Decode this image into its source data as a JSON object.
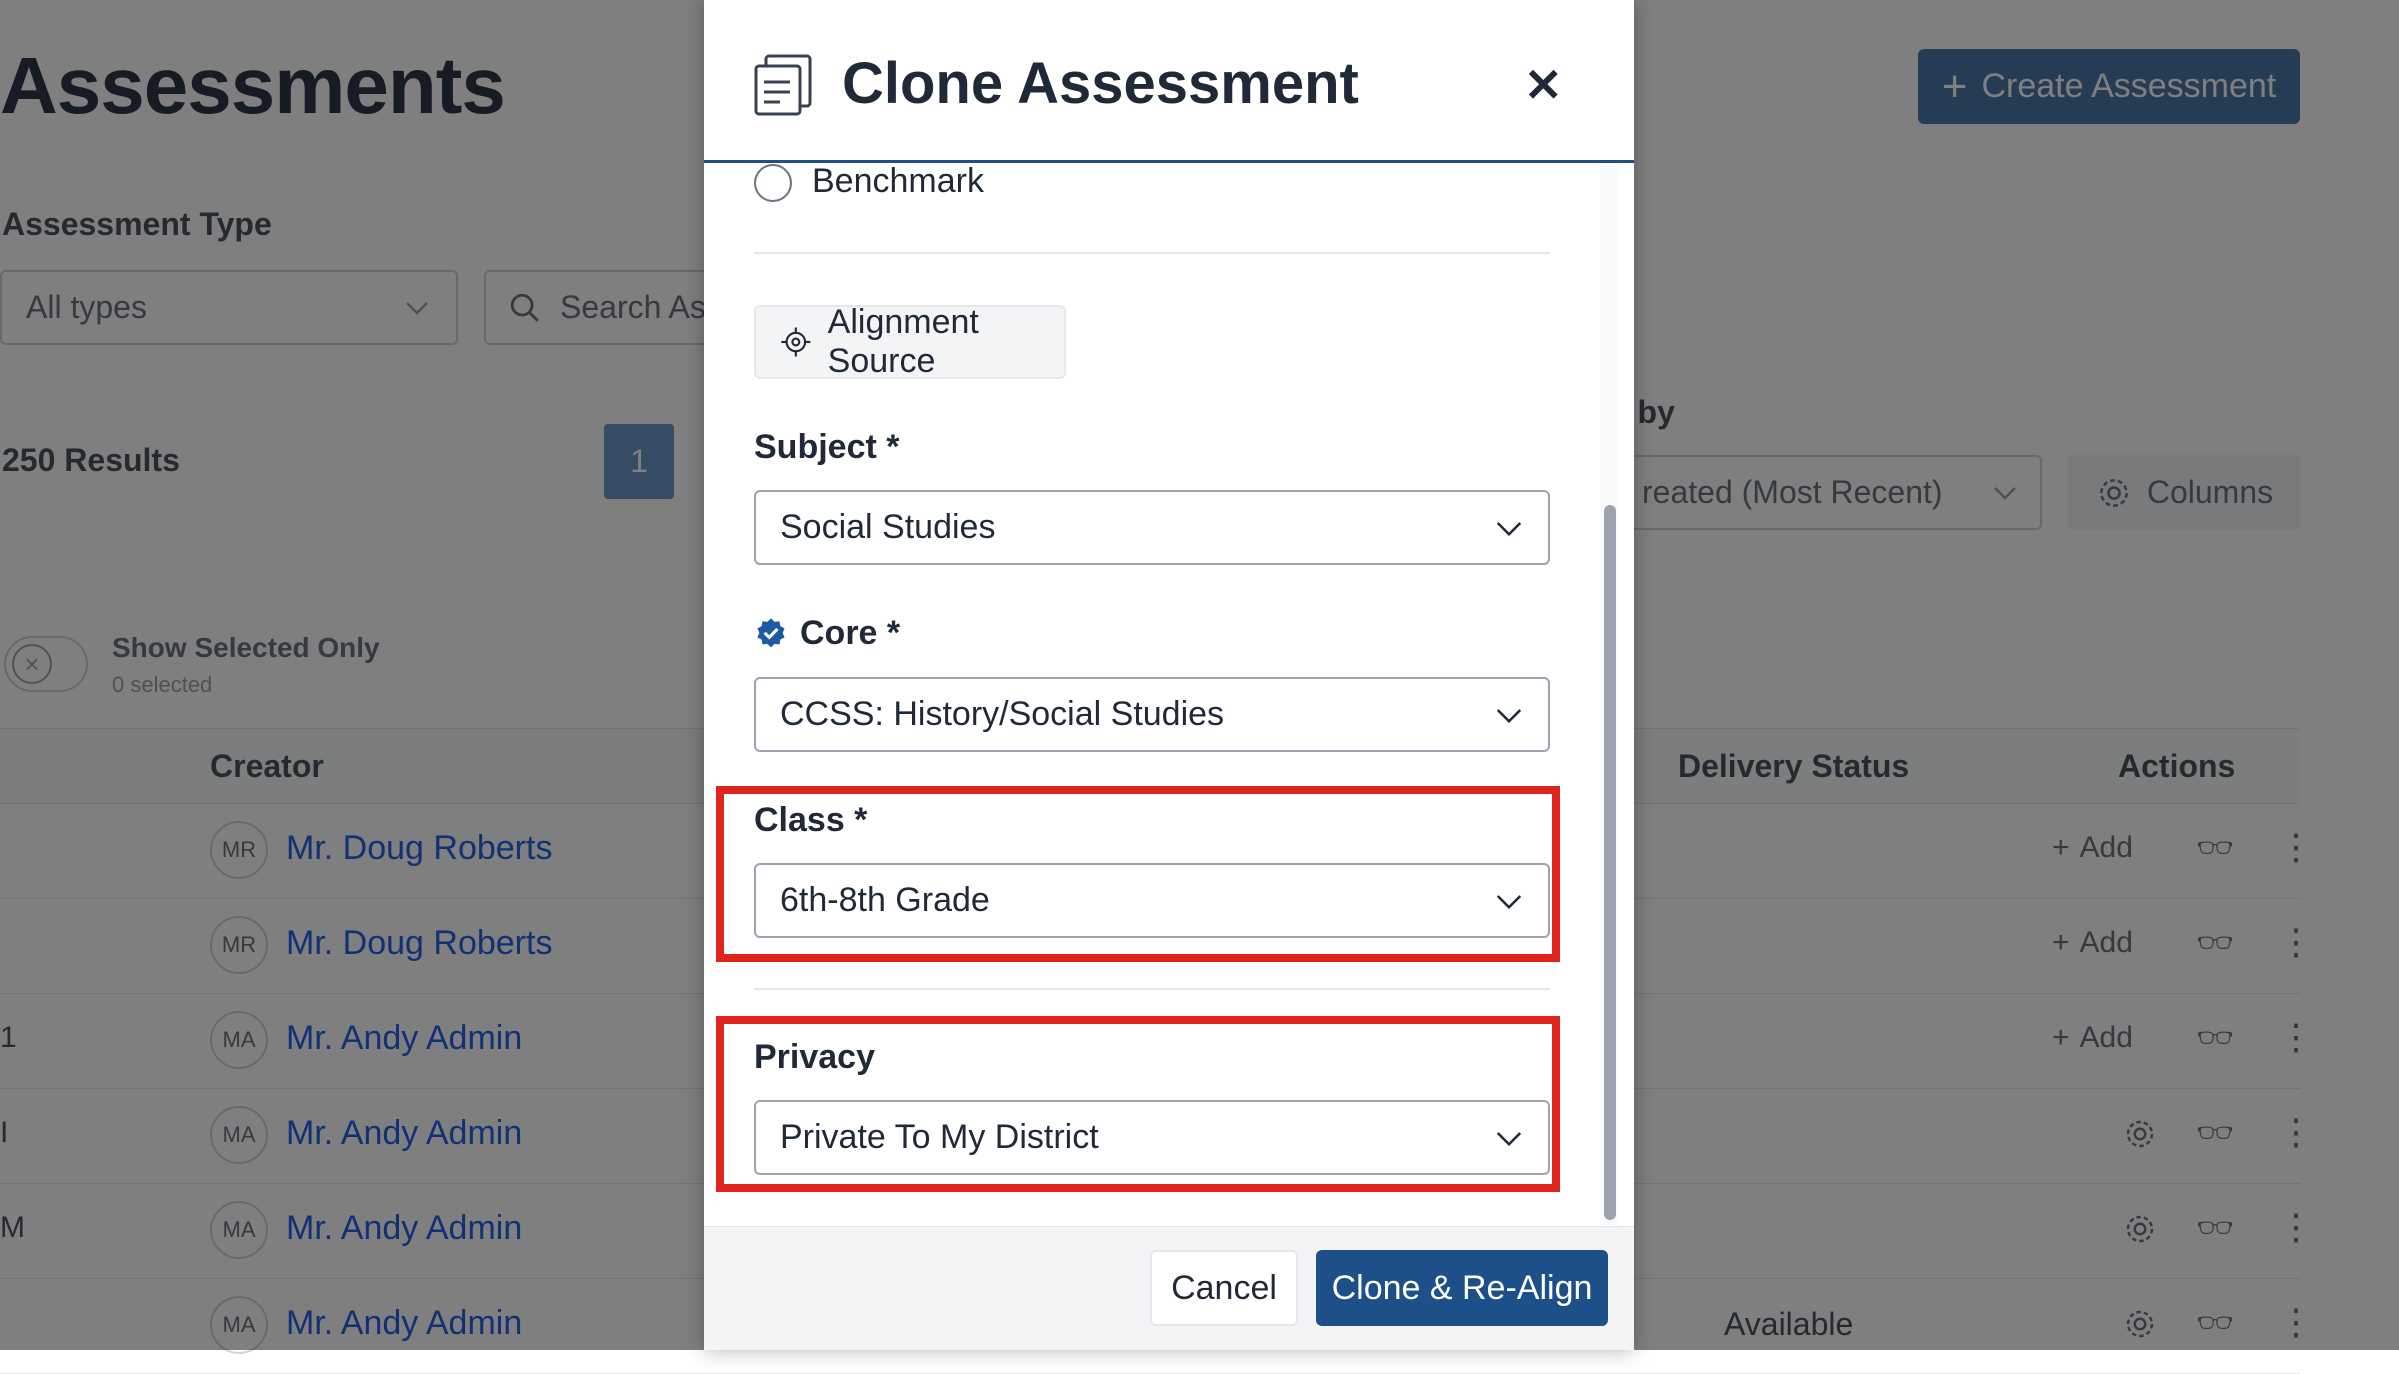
{
  "page": {
    "title": "Assessments",
    "create_button": "Create Assessment",
    "filter_label": "Assessment Type",
    "type_select_value": "All types",
    "search_placeholder": "Search As",
    "results_count": "250 Results",
    "current_page": "1",
    "sort_label": "t by",
    "sort_value": "reated (Most Recent)",
    "columns_button": "Columns",
    "show_selected_label": "Show Selected Only",
    "selected_count": "0 selected",
    "table": {
      "headers": [
        "Creator",
        "Delivery Status",
        "Actions"
      ],
      "rows": [
        {
          "initials": "MR",
          "creator": "Mr. Doug Roberts",
          "left_fragment": "",
          "action": "Add",
          "status": ""
        },
        {
          "initials": "MR",
          "creator": "Mr. Doug Roberts",
          "left_fragment": "",
          "action": "Add",
          "status": ""
        },
        {
          "initials": "MA",
          "creator": "Mr. Andy Admin",
          "left_fragment": "1",
          "action": "Add",
          "status": ""
        },
        {
          "initials": "MA",
          "creator": "Mr. Andy Admin",
          "left_fragment": "I",
          "action": "settings",
          "status": ""
        },
        {
          "initials": "MA",
          "creator": "Mr. Andy Admin",
          "left_fragment": "M",
          "action": "settings",
          "status": ""
        },
        {
          "initials": "MA",
          "creator": "Mr. Andy Admin",
          "left_fragment": "",
          "action": "settings",
          "status": "Available"
        }
      ]
    }
  },
  "modal": {
    "title": "Clone Assessment",
    "radio_option": "Benchmark",
    "alignment_source_button": "Alignment Source",
    "subject": {
      "label": "Subject *",
      "value": "Social Studies"
    },
    "core": {
      "label": "Core *",
      "value": "CCSS: History/Social Studies"
    },
    "class": {
      "label": "Class *",
      "value": "6th-8th Grade"
    },
    "privacy": {
      "label": "Privacy",
      "value": "Private To My District"
    },
    "cancel_button": "Cancel",
    "clone_button": "Clone & Re-Align"
  },
  "colors": {
    "primary": "#1d4f88",
    "highlight": "#e0251f",
    "link": "#2563eb",
    "verified_badge": "#1d5aa3"
  },
  "icons": {
    "modal_header": "document-clone-icon",
    "close": "close-icon",
    "alignment": "target-icon",
    "verified": "verified-badge-icon",
    "dropdown": "chevron-down-icon"
  }
}
